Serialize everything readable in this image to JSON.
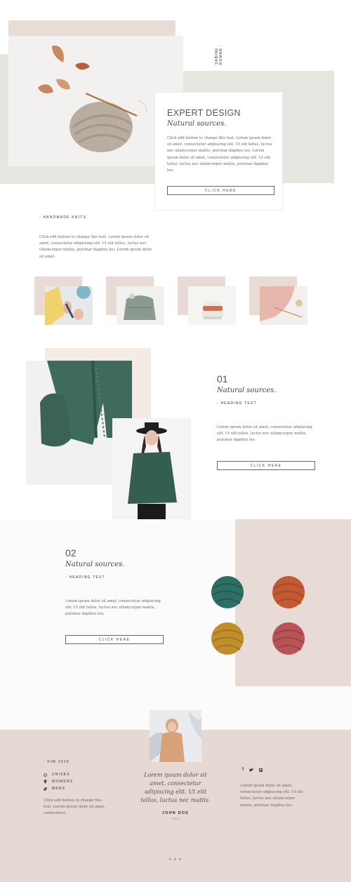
{
  "side_credit": "SABINE ROMAN -",
  "hero": {
    "title": "EXPERT DESIGN",
    "subtitle": "Natural sources.",
    "body": "Click edit button to change this text. Lorem ipsum dolor sit amet, consectetur adipiscing elit. Ut elit tellus, luctus nec ullamcorper mattis, pulvinar dapibus leo. Lorem ipsum dolor sit amet, consectetur adipiscing elit. Ut elit tellus, luctus nec ullamcorper mattis, pulvinar dapibus leo.",
    "button": "CLICK HERE"
  },
  "knits": {
    "heading": "- HANDMADE KNITS",
    "body": "Click edit button to change this text. Lorem ipsum dolor sit amet, consectetur adipiscing elit. Ut elit tellus, luctus nec ullamcorper mattis, pulvinar dapibus leo. Lorem ipsum dolor sit amet."
  },
  "feature1": {
    "number": "01",
    "subtitle": "Natural sources.",
    "heading": "- HEADING TEXT",
    "body": "Lorem ipsum dolor sit amet, consectetur adipiscing elit. Ut elit tellus, luctus nec ullamcorper mattis, pulvinar dapibus leo.",
    "button": "CLICK HERE"
  },
  "feature2": {
    "number": "02",
    "subtitle": "Natural sources.",
    "heading": "- HEADING TEXT",
    "body": "Lorem ipsum dolor sit amet, consectetur adipiscing elit. Ut elit tellus, luctus nec ullamcorper mattis, pulvinar dapibus leo.",
    "button": "CLICK HERE"
  },
  "footer": {
    "season": "- F/W 2019",
    "links": [
      {
        "icon": "circle-icon",
        "label": "UNISEX"
      },
      {
        "icon": "location-pin-icon",
        "label": "WOMENS"
      },
      {
        "icon": "leaf-icon",
        "label": "MENS"
      }
    ],
    "left_text": "Click edit button to change this text. Lorem ipsum dolor sit amet, consectetur.",
    "quote": "Lorem ipsum dolor sit amet, consectetur adipiscing elit. Ut elit tellus, luctus nec mattis.",
    "author": "JOHN DOE",
    "author_role": "CEO",
    "social": [
      "facebook-icon",
      "twitter-icon",
      "instagram-icon"
    ],
    "right_text": "Lorem ipsum dolor sit amet, consectetur adipiscing elit. Ut elit tellus, luctus nec ullamcorper mattis, pulvinar dapibus leo."
  },
  "colors": {
    "beige": "#e8e4dc",
    "blush": "#e8d8d4",
    "pink_footer": "#e6d9d4",
    "dots": "#d98a8a"
  }
}
